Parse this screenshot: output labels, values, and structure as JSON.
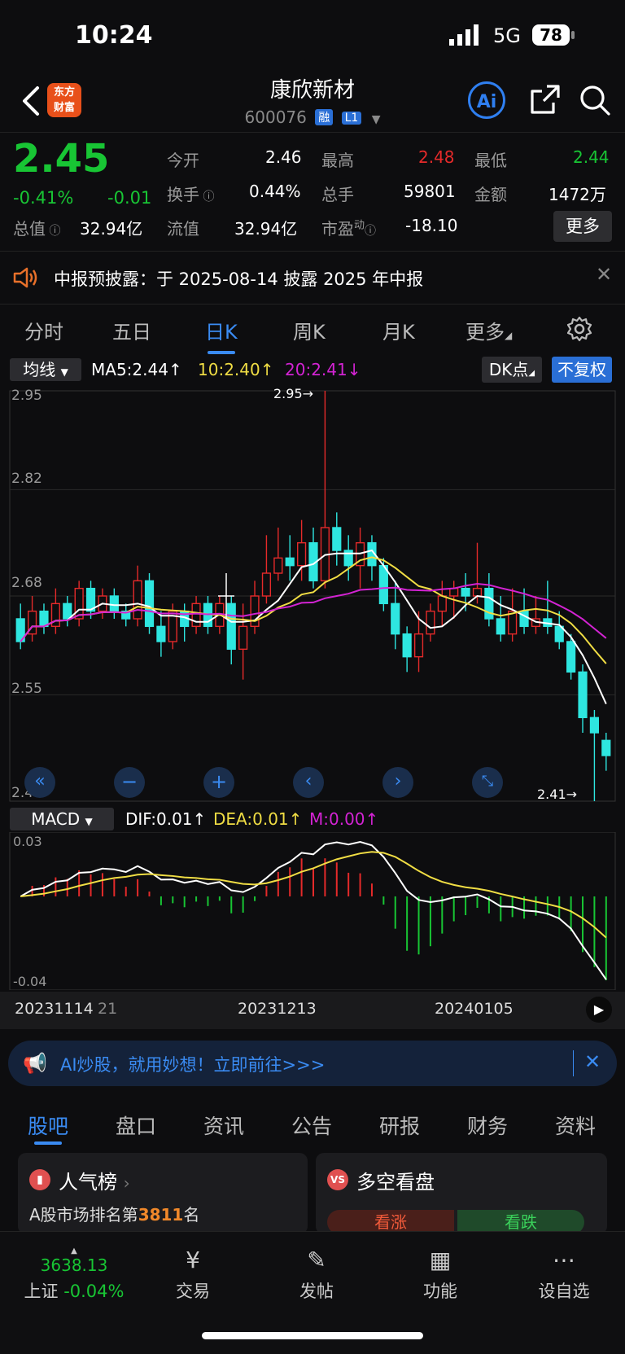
{
  "status": {
    "time": "10:24",
    "network": "5G",
    "battery": "78"
  },
  "header": {
    "title": "康欣新材",
    "code": "600076",
    "tag1": "融",
    "tag2": "L1",
    "ai_label": "Ai",
    "logo_line1": "东方",
    "logo_line2": "财富"
  },
  "quote": {
    "price": "2.45",
    "change_pct": "-0.41%",
    "change": "-0.01",
    "open_label": "今开",
    "open": "2.46",
    "high_label": "最高",
    "high": "2.48",
    "low_label": "最低",
    "low": "2.44",
    "turnover_label": "换手",
    "turnover": "0.44%",
    "volume_label": "总手",
    "volume": "59801",
    "amount_label": "金额",
    "amount": "1472万",
    "mktcap_label": "总值",
    "mktcap": "32.94亿",
    "float_label": "流值",
    "float": "32.94亿",
    "pe_label": "市盈",
    "pe_sup": "动",
    "pe": "-18.10",
    "more": "更多"
  },
  "notice": {
    "label": "中报预披露：",
    "text": "于 2025-08-14 披露 2025 年中报"
  },
  "tabs": [
    "分时",
    "五日",
    "日K",
    "周K",
    "月K",
    "更多"
  ],
  "active_tab": "日K",
  "ma": {
    "selector": "均线",
    "ma5": "MA5:2.44",
    "ma10": "10:2.40",
    "ma20": "20:2.41",
    "dk": "DK点",
    "fq": "不复权"
  },
  "kchart": {
    "y_labels": [
      "2.95",
      "2.82",
      "2.68",
      "2.55",
      "2.41"
    ],
    "high_marker": "2.95→",
    "low_marker": "2.41→"
  },
  "macd": {
    "selector": "MACD",
    "dif": "DIF:0.01",
    "dea": "DEA:0.01",
    "m": "M:0.00",
    "y_top": "0.03",
    "y_bottom": "-0.04"
  },
  "dates": [
    "20231114",
    "21",
    "20231213",
    "20240105"
  ],
  "chart_data": {
    "type": "candlestick",
    "ylim": [
      2.41,
      2.95
    ],
    "candles": [
      [
        2.65,
        2.62,
        2.67,
        2.61
      ],
      [
        2.63,
        2.66,
        2.68,
        2.62
      ],
      [
        2.66,
        2.64,
        2.67,
        2.63
      ],
      [
        2.64,
        2.67,
        2.69,
        2.63
      ],
      [
        2.67,
        2.65,
        2.68,
        2.64
      ],
      [
        2.65,
        2.69,
        2.7,
        2.64
      ],
      [
        2.69,
        2.66,
        2.7,
        2.65
      ],
      [
        2.66,
        2.68,
        2.69,
        2.65
      ],
      [
        2.68,
        2.66,
        2.69,
        2.65
      ],
      [
        2.66,
        2.65,
        2.67,
        2.64
      ],
      [
        2.65,
        2.7,
        2.72,
        2.64
      ],
      [
        2.7,
        2.64,
        2.71,
        2.63
      ],
      [
        2.64,
        2.62,
        2.66,
        2.6
      ],
      [
        2.62,
        2.66,
        2.67,
        2.61
      ],
      [
        2.66,
        2.64,
        2.67,
        2.62
      ],
      [
        2.64,
        2.67,
        2.68,
        2.63
      ],
      [
        2.67,
        2.64,
        2.68,
        2.63
      ],
      [
        2.64,
        2.67,
        2.68,
        2.63
      ],
      [
        2.67,
        2.61,
        2.68,
        2.59
      ],
      [
        2.61,
        2.64,
        2.67,
        2.57
      ],
      [
        2.64,
        2.68,
        2.7,
        2.63
      ],
      [
        2.68,
        2.71,
        2.76,
        2.67
      ],
      [
        2.71,
        2.73,
        2.77,
        2.7
      ],
      [
        2.73,
        2.72,
        2.76,
        2.7
      ],
      [
        2.72,
        2.75,
        2.78,
        2.7
      ],
      [
        2.75,
        2.7,
        2.77,
        2.69
      ],
      [
        2.7,
        2.77,
        2.95,
        2.69
      ],
      [
        2.77,
        2.74,
        2.79,
        2.72
      ],
      [
        2.74,
        2.72,
        2.76,
        2.7
      ],
      [
        2.72,
        2.75,
        2.77,
        2.69
      ],
      [
        2.75,
        2.72,
        2.76,
        2.7
      ],
      [
        2.72,
        2.67,
        2.73,
        2.66
      ],
      [
        2.67,
        2.63,
        2.7,
        2.61
      ],
      [
        2.63,
        2.6,
        2.64,
        2.58
      ],
      [
        2.6,
        2.63,
        2.66,
        2.58
      ],
      [
        2.63,
        2.66,
        2.67,
        2.62
      ],
      [
        2.66,
        2.68,
        2.7,
        2.64
      ],
      [
        2.68,
        2.69,
        2.7,
        2.65
      ],
      [
        2.69,
        2.68,
        2.71,
        2.66
      ],
      [
        2.68,
        2.69,
        2.75,
        2.67
      ],
      [
        2.69,
        2.65,
        2.71,
        2.64
      ],
      [
        2.65,
        2.63,
        2.68,
        2.62
      ],
      [
        2.63,
        2.66,
        2.69,
        2.62
      ],
      [
        2.66,
        2.64,
        2.69,
        2.63
      ],
      [
        2.64,
        2.65,
        2.68,
        2.63
      ],
      [
        2.65,
        2.64,
        2.7,
        2.63
      ],
      [
        2.64,
        2.62,
        2.66,
        2.61
      ],
      [
        2.62,
        2.58,
        2.63,
        2.57
      ],
      [
        2.58,
        2.52,
        2.59,
        2.5
      ],
      [
        2.52,
        2.5,
        2.53,
        2.41
      ],
      [
        2.49,
        2.47,
        2.5,
        2.45
      ]
    ]
  },
  "ai_banner": "AI炒股，就用妙想！立即前往>>>",
  "bottom_tabs": [
    "股吧",
    "盘口",
    "资讯",
    "公告",
    "研报",
    "财务",
    "资料"
  ],
  "cards": {
    "rank_title": "人气榜",
    "rank_text_prefix": "A股市场排名第",
    "rank_num": "3811",
    "rank_suffix": "名",
    "bullbear_title": "多空看盘",
    "bull": "看涨",
    "bear": "看跌"
  },
  "nav": {
    "index_value": "3638.13",
    "index_name": "上证",
    "index_change": "-0.04%",
    "trade": "交易",
    "post": "发帖",
    "func": "功能",
    "watch": "设自选"
  },
  "colors": {
    "up": "#e52a2a",
    "down": "#2ee6e0",
    "accent": "#3a8bf2",
    "ma5": "#ffffff",
    "ma10": "#f0dd44",
    "ma20": "#d323d3"
  }
}
